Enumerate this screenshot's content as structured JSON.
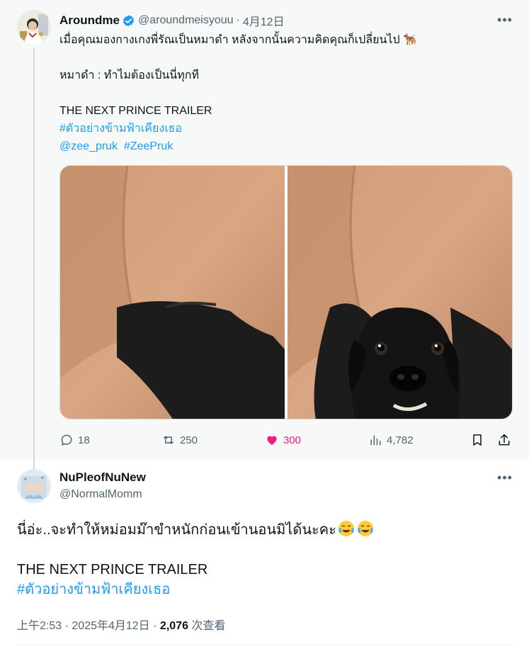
{
  "parent_tweet": {
    "author_name": "Aroundme",
    "handle": "@aroundmeisyouu",
    "separator": "·",
    "date": "4月12日",
    "more_label": "•••",
    "text_line1": "เมื่อคุณมองกางเกงพี่รัณเป็นหมาดำ หลังจากนั้นความคิดคุณก็เปลี่ยนไป",
    "text_line1_emoji": "🐕‍🦺",
    "text_line2": "หมาดำ : ทำไมต้องเป็นนี่ทุกที",
    "text_line3": "THE NEXT PRINCE TRAILER",
    "hashtag1": "#ตัวอย่างข้ามฟ้าเคียงเธอ",
    "mention": "@zee_pruk",
    "hashtag2": "#ZeePruk",
    "actions": {
      "replies": "18",
      "reposts": "250",
      "likes": "300",
      "views": "4,782"
    }
  },
  "reply_tweet": {
    "author_name": "NuPleofNuNew",
    "handle": "@NormalMomm",
    "more_label": "•••",
    "text_line1": "นี่อ่ะ..จะทำให้หม่อมม๊าขำหนักก่อนเข้านอนมิได้นะคะ",
    "text_line2": "THE NEXT PRINCE TRAILER",
    "hashtag1": "#ตัวอย่างข้ามฟ้าเคียงเธอ",
    "time": "上午2:53",
    "separator": "·",
    "date": "2025年4月12日",
    "views_count": "2,076",
    "views_label": "次查看"
  },
  "colors": {
    "link": "#1d9bf0",
    "like": "#f91880",
    "muted": "#536471",
    "verified": "#1d9bf0"
  }
}
